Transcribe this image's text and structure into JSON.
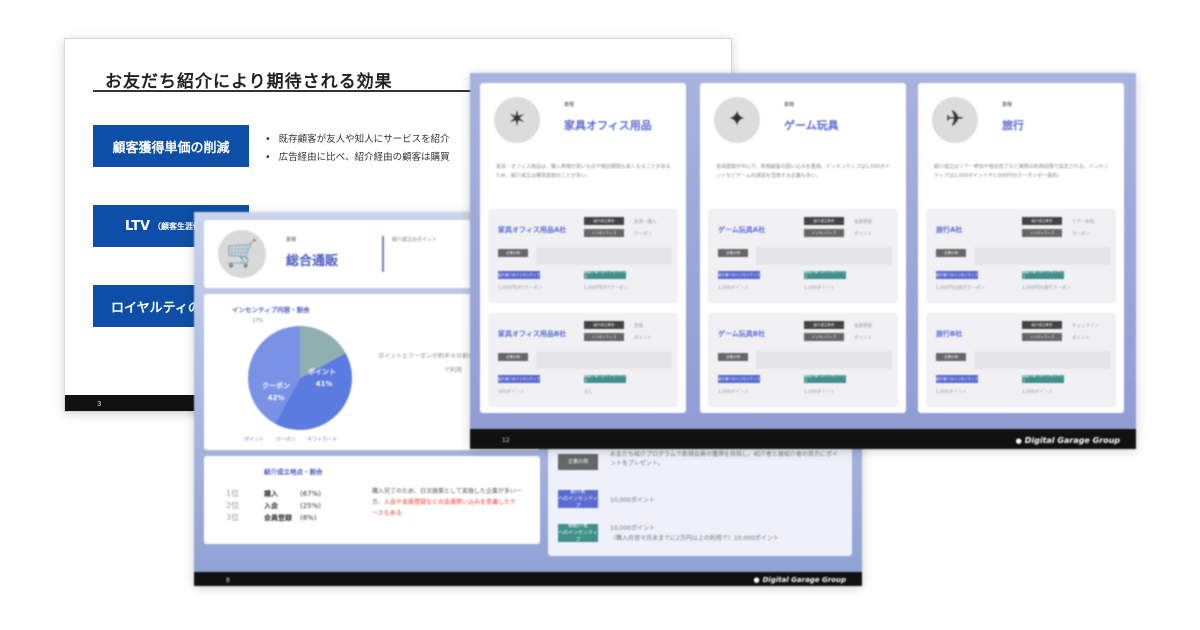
{
  "slide3": {
    "title": "お友だち紹介により期待される効果",
    "benefits": [
      {
        "label": "顧客獲得単価の削減",
        "note": ""
      },
      {
        "label": "LTV",
        "note": "（顧客生涯価値）"
      },
      {
        "label": "ロイヤルティの"
      }
    ],
    "bullets": [
      "既存顧客が友人や知人にサービスを紹介",
      "広告経由に比べ、紹介経由の顧客は購買"
    ],
    "page_number": "3"
  },
  "slide8": {
    "category_label": "業種",
    "category_name": "総合通販",
    "description": "紹介成立のポイント",
    "pie_title": "インセンティブ内容・割合",
    "pie": [
      {
        "label": "ポイント",
        "value": 41,
        "color": "#5b7be0"
      },
      {
        "label": "クーポン",
        "value": 42,
        "color": "#7a92e6"
      },
      {
        "label": "",
        "value": 17,
        "color": "#8fb0b0"
      }
    ],
    "pie_top_label": "17%",
    "pie_note": "ポイントとクーポンが約半々の割合で、様々なカテゴリで利用",
    "legend": [
      "ポイント",
      "クーポン",
      "ギフトカード"
    ],
    "rank_title": "紹介成立地点・割合",
    "rank_nums": [
      "1位",
      "2位",
      "3位"
    ],
    "ranks": [
      {
        "label": "購入",
        "pct": "(67%)"
      },
      {
        "label": "入会",
        "pct": "(25%)"
      },
      {
        "label": "会員登録",
        "pct": "(8%)"
      }
    ],
    "rank_note_plain": "購入完了のため、日次施策として実施した企業が多い一方、",
    "rank_note_red": "入会や会員登録などの会員際い込みを意識したケースもある",
    "lower_right": {
      "tag1": "企業の例",
      "tag2_top": "紹介者",
      "tag2_bottom": "へのインセンティブ",
      "tag3_top": "被紹介者",
      "tag3_bottom": "へのインセンティブ",
      "text1": "お友だち紹介プログラムで新規会員の獲得を目指し、紹介者と被紹介者の双方にポイントをプレゼント。",
      "val2": "10,000ポイント",
      "val3a": "10,000ポイント",
      "val3b": "（購入月翌々月末までに2万円以上の利用で）10,000ポイント"
    },
    "page_number": "8",
    "brand": "Digital Garage Group"
  },
  "slide12": {
    "columns": [
      {
        "label": "業種",
        "name": "家具オフィス用品",
        "icon": "armchair-icon",
        "desc": "家具・オフィス用品は、購入単価が高いものや検討期間も長くなることがあるため、紹介成立は購買直前のことが多い。",
        "sub_a": {
          "name": "家具オフィス用品A社",
          "chip1": "紹介成立条件",
          "chip2": "インセンティブ",
          "t1": "友達一購入",
          "t2": "クーポン",
          "bv1": "1,000円OFFクーポン",
          "bv2": "1,000円OFFクーポン"
        },
        "sub_b": {
          "name": "家具オフィス用品B社",
          "chip1": "紹介成立条件",
          "chip2": "インセンティブ",
          "t1": "登録",
          "t2": "ポイント",
          "bv1": "400ポイント",
          "bv2": "なし"
        }
      },
      {
        "label": "業種",
        "name": "ゲーム玩具",
        "icon": "gamepad-icon",
        "desc": "会員登録が中心で、新規顧客の囲い込みを重視。インセンティブは1,000ポイントなどゲーム内通貨を活用する企業も多い。",
        "sub_a": {
          "name": "ゲーム玩具A社",
          "chip1": "紹介成立条件",
          "chip2": "インセンティブ",
          "t1": "会員登録",
          "t2": "ポイント",
          "bv1": "1,000ポイント",
          "bv2": "1,000ポイント"
        },
        "sub_b": {
          "name": "ゲーム玩具B社",
          "chip1": "紹介成立条件",
          "chip2": "インセンティブ",
          "t1": "会員登録",
          "t2": "ポイント",
          "bv1": "1,000ポイント",
          "bv2": "1,000ポイント"
        }
      },
      {
        "label": "業種",
        "name": "旅行",
        "icon": "airplane-icon",
        "desc": "紹介成立はツアー参加や宿泊完了など実際の利用段階で設定される。インセンティブは1,000ポイントや1,000円分クーポンが一般的。",
        "sub_a": {
          "name": "旅行A社",
          "chip1": "紹介成立条件",
          "chip2": "インセンティブ",
          "t1": "ツアー参加",
          "t2": "クーポン",
          "bv1": "1,000円分旅行クーポン",
          "bv2": "1,000円分旅行クーポン"
        },
        "sub_b": {
          "name": "旅行B社",
          "chip1": "紹介成立条件",
          "chip2": "インセンティブ",
          "t1": "チェックイン",
          "t2": "ポイント",
          "bv1": "1,000ポイント",
          "bv2": "1,000ポイント"
        }
      }
    ],
    "tag_ex": "企業の例",
    "btn_blue": "紹介者へのインセンティブ",
    "btn_teal": "被紹介者へのインセンティブ",
    "page_number": "12",
    "brand": "Digital Garage Group"
  }
}
